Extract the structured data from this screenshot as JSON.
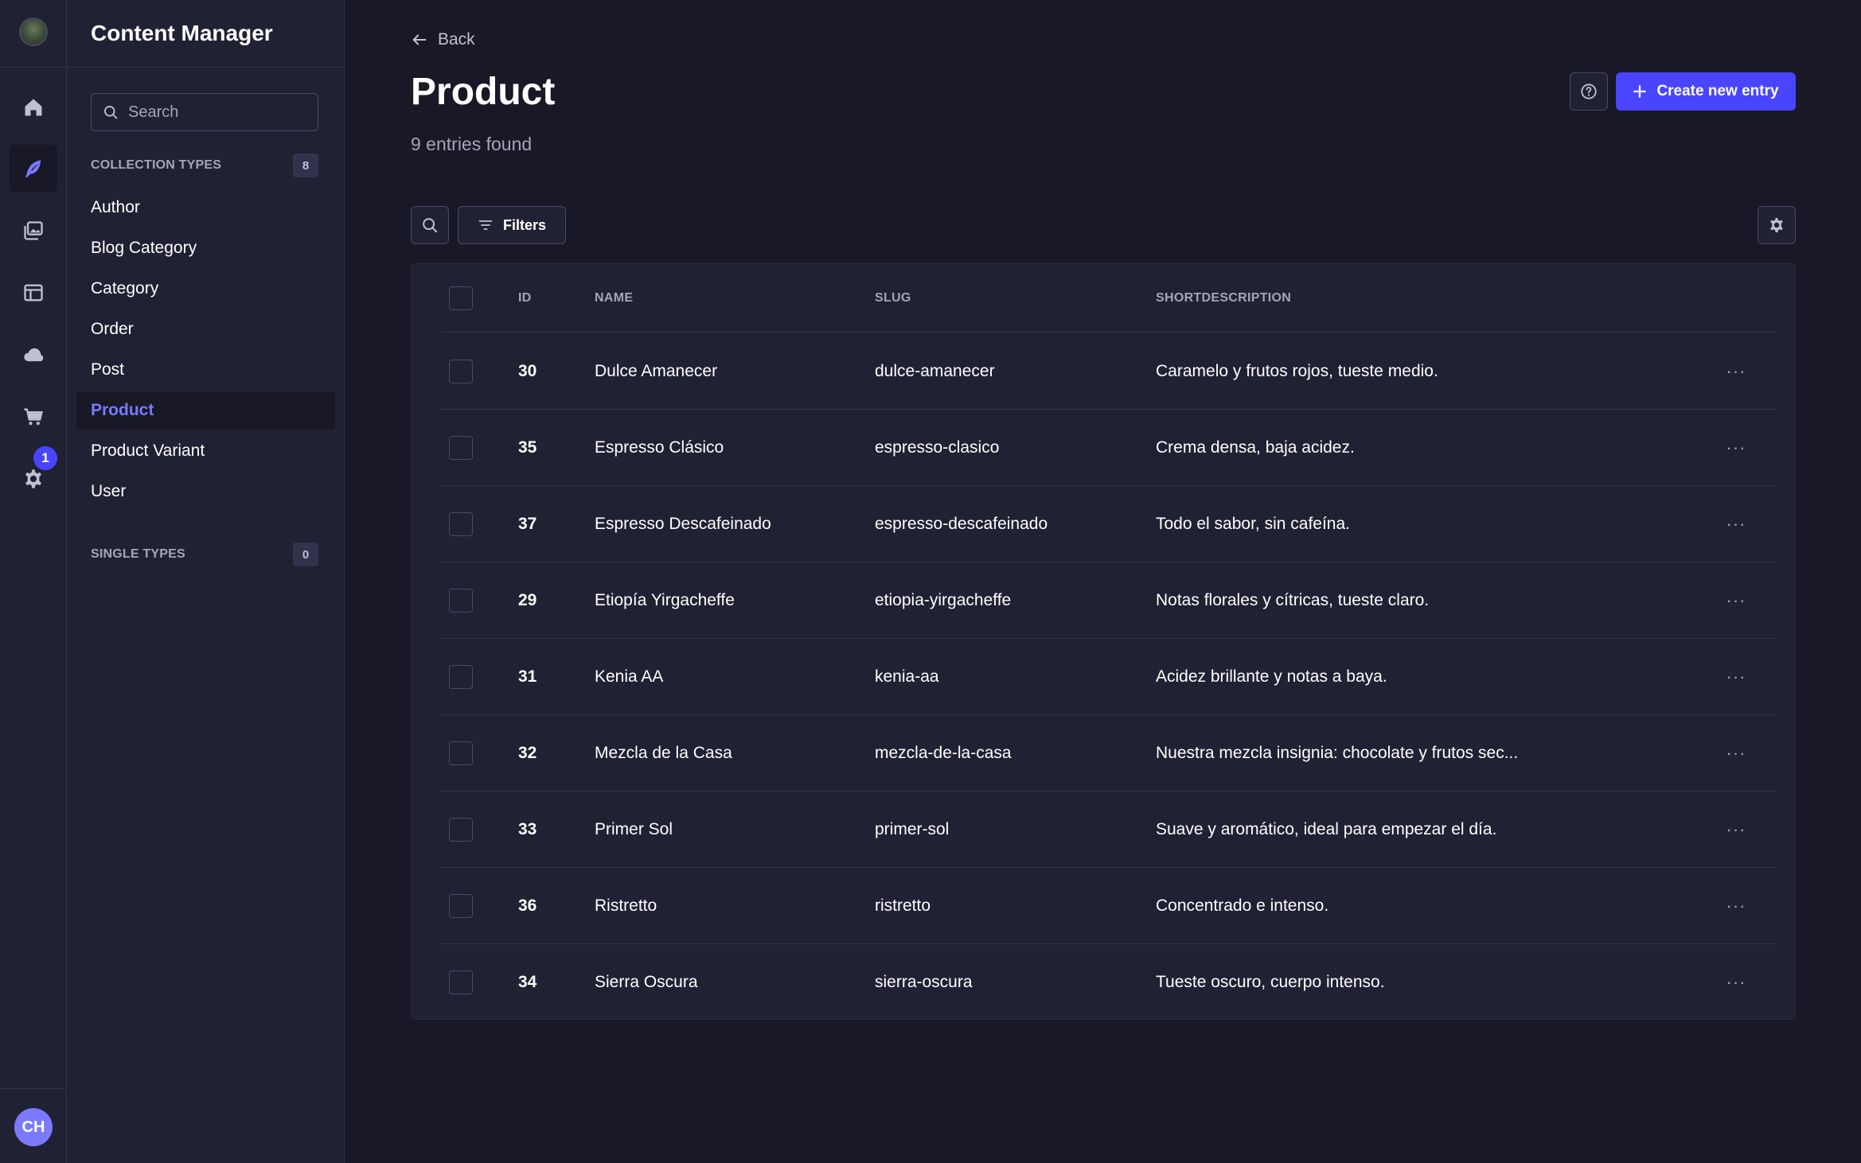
{
  "colors": {
    "background": "#181826",
    "panel": "#212134",
    "border": "#32324d",
    "primary": "#4945ff",
    "primary_light": "#7b79ff",
    "text_muted": "#a5a5ba"
  },
  "rail": {
    "icons": [
      "logo-icon",
      "home-icon",
      "feather-icon",
      "media-library-icon",
      "layout-icon",
      "cloud-icon",
      "cart-icon",
      "settings-icon"
    ],
    "settings_badge": "1",
    "avatar_initials": "CH"
  },
  "sidebar": {
    "title": "Content Manager",
    "search_placeholder": "Search",
    "collection_types": {
      "label": "COLLECTION TYPES",
      "count": "8",
      "items": [
        {
          "label": "Author"
        },
        {
          "label": "Blog Category"
        },
        {
          "label": "Category"
        },
        {
          "label": "Order"
        },
        {
          "label": "Post"
        },
        {
          "label": "Product"
        },
        {
          "label": "Product Variant"
        },
        {
          "label": "User"
        }
      ],
      "active": "Product"
    },
    "single_types": {
      "label": "SINGLE TYPES",
      "count": "0"
    }
  },
  "header": {
    "back_label": "Back",
    "title": "Product",
    "subtitle": "9 entries found",
    "create_label": "Create new entry"
  },
  "toolbar": {
    "filters_label": "Filters"
  },
  "table": {
    "columns": [
      "ID",
      "NAME",
      "SLUG",
      "SHORTDESCRIPTION"
    ],
    "rows": [
      {
        "id": "30",
        "name": "Dulce Amanecer",
        "slug": "dulce-amanecer",
        "desc": "Caramelo y frutos rojos, tueste medio."
      },
      {
        "id": "35",
        "name": "Espresso Clásico",
        "slug": "espresso-clasico",
        "desc": "Crema densa, baja acidez."
      },
      {
        "id": "37",
        "name": "Espresso Descafeinado",
        "slug": "espresso-descafeinado",
        "desc": "Todo el sabor, sin cafeína."
      },
      {
        "id": "29",
        "name": "Etiopía Yirgacheffe",
        "slug": "etiopia-yirgacheffe",
        "desc": "Notas florales y cítricas, tueste claro."
      },
      {
        "id": "31",
        "name": "Kenia AA",
        "slug": "kenia-aa",
        "desc": "Acidez brillante y notas a baya."
      },
      {
        "id": "32",
        "name": "Mezcla de la Casa",
        "slug": "mezcla-de-la-casa",
        "desc": "Nuestra mezcla insignia: chocolate y frutos sec..."
      },
      {
        "id": "33",
        "name": "Primer Sol",
        "slug": "primer-sol",
        "desc": "Suave y aromático, ideal para empezar el día."
      },
      {
        "id": "36",
        "name": "Ristretto",
        "slug": "ristretto",
        "desc": "Concentrado e intenso."
      },
      {
        "id": "34",
        "name": "Sierra Oscura",
        "slug": "sierra-oscura",
        "desc": "Tueste oscuro, cuerpo intenso."
      }
    ],
    "row_menu_label": "···"
  }
}
